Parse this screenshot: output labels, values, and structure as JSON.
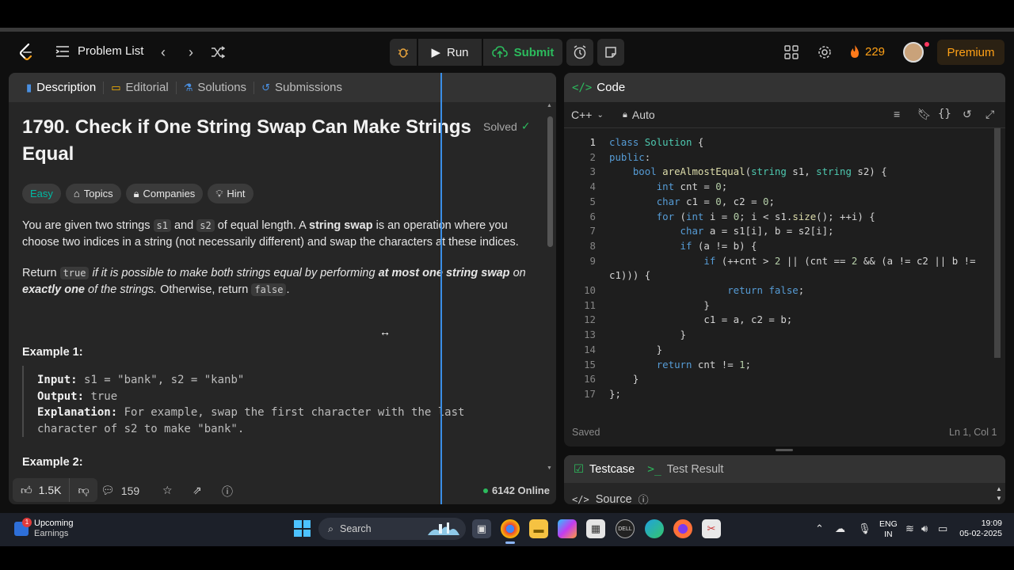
{
  "nav": {
    "problem_list": "Problem List",
    "run": "Run",
    "submit": "Submit",
    "streak": "229",
    "premium": "Premium"
  },
  "tabs": {
    "description": "Description",
    "editorial": "Editorial",
    "solutions": "Solutions",
    "submissions": "Submissions"
  },
  "problem": {
    "title": "1790. Check if One String Swap Can Make Strings Equal",
    "status": "Solved",
    "tags": [
      "Easy",
      "Topics",
      "Companies",
      "Hint"
    ],
    "p1": {
      "a": "You are given two strings ",
      "s1": "s1",
      "b": " and ",
      "s2": "s2",
      "c": " of equal length. A ",
      "strong": "string swap",
      "d": " is an operation where you choose two indices in a string (not necessarily different) and swap the characters at these indices."
    },
    "p2": {
      "a": "Return ",
      "true": "true",
      "b": " if it is possible to make both strings equal by performing ",
      "bold1": "at most one string swap",
      "c": " on ",
      "bold2": "exactly one",
      "d": " of the strings.",
      "e": " Otherwise, return ",
      "false": "false",
      "f": "."
    },
    "example1_heading": "Example 1:",
    "example1": {
      "input_label": "Input:",
      "input": " s1 = \"bank\", s2 = \"kanb\"",
      "output_label": "Output:",
      "output": " true",
      "explanation_label": "Explanation:",
      "explanation_1": " For example, swap the first character with the last",
      "explanation_2": "character of s2 to make \"bank\"."
    },
    "example2_heading": "Example 2:"
  },
  "footer": {
    "likes": "1.5K",
    "comments": "159",
    "online": "6142 Online"
  },
  "code_panel": {
    "title": "Code",
    "language": "C++",
    "mode": "Auto",
    "status": "Saved",
    "cursor": "Ln 1, Col 1",
    "lines": [
      {
        "n": "1",
        "t": "class Solution {"
      },
      {
        "n": "2",
        "t": "public:"
      },
      {
        "n": "3",
        "t": "    bool areAlmostEqual(string s1, string s2) {"
      },
      {
        "n": "4",
        "t": "        int cnt = 0;"
      },
      {
        "n": "5",
        "t": "        char c1 = 0, c2 = 0;"
      },
      {
        "n": "6",
        "t": "        for (int i = 0; i < s1.size(); ++i) {"
      },
      {
        "n": "7",
        "t": "            char a = s1[i], b = s2[i];"
      },
      {
        "n": "8",
        "t": "            if (a != b) {"
      },
      {
        "n": "9",
        "t": "                if (++cnt > 2 || (cnt == 2 && (a != c2 || b !="
      },
      {
        "n": "",
        "t": "c1))) {"
      },
      {
        "n": "10",
        "t": "                    return false;"
      },
      {
        "n": "11",
        "t": "                }"
      },
      {
        "n": "12",
        "t": "                c1 = a, c2 = b;"
      },
      {
        "n": "13",
        "t": "            }"
      },
      {
        "n": "14",
        "t": "        }"
      },
      {
        "n": "15",
        "t": "        return cnt != 1;"
      },
      {
        "n": "16",
        "t": "    }"
      },
      {
        "n": "17",
        "t": "};"
      }
    ]
  },
  "test_panel": {
    "testcase": "Testcase",
    "test_result": "Test Result",
    "source": "Source"
  },
  "taskbar": {
    "weather_title": "Upcoming",
    "weather_sub": "Earnings",
    "weather_badge": "1",
    "search": "Search",
    "lang_1": "ENG",
    "lang_2": "IN",
    "time": "19:09",
    "date": "05-02-2025"
  },
  "colors": {
    "accent_green": "#2cbb5d",
    "accent_orange": "#ffa116",
    "easy": "#00b8a3",
    "divider_blue": "#3a8ee6"
  }
}
